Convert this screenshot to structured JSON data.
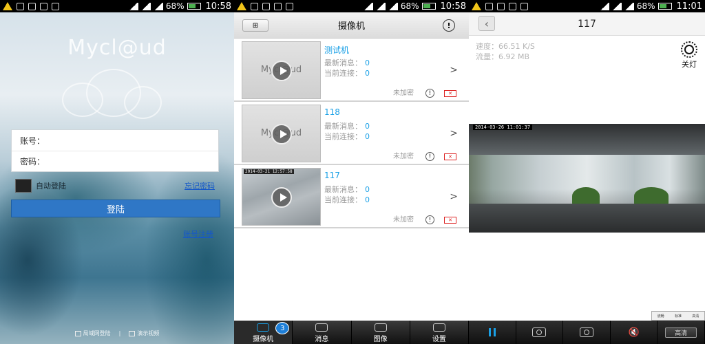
{
  "status_bars": [
    {
      "battery": "68%",
      "time": "10:58"
    },
    {
      "battery": "68%",
      "time": "10:58"
    },
    {
      "battery": "68%",
      "time": "11:01"
    }
  ],
  "login": {
    "logo": "Mycl@ud",
    "account_label": "账号：",
    "password_label": "密码：",
    "auto_login": "自动登陆",
    "forgot_password": "忘记密码",
    "login_button": "登陆",
    "register": "账号注册",
    "lan_login": "局域网登陆",
    "demo_video": "演示视频"
  },
  "camera_list": {
    "title": "摄像机",
    "msg_label": "最新消息：",
    "conn_label": "当前连接：",
    "unencrypted": "未加密",
    "cameras": [
      {
        "name": "测试机",
        "messages": "0",
        "connections": "0",
        "thumb": "logo",
        "timestamp": ""
      },
      {
        "name": "118",
        "messages": "0",
        "connections": "0",
        "thumb": "logo",
        "timestamp": ""
      },
      {
        "name": "117",
        "messages": "0",
        "connections": "0",
        "thumb": "photo",
        "timestamp": "2014-03-21 12:57:58"
      }
    ],
    "thumb_logo": "Mycl@ud",
    "tabs": [
      {
        "label": "摄像机",
        "icon": "camera-icon",
        "badge": "3",
        "active": true
      },
      {
        "label": "消息",
        "icon": "message-icon",
        "badge": "",
        "active": false
      },
      {
        "label": "图像",
        "icon": "image-icon",
        "badge": "",
        "active": false
      },
      {
        "label": "设置",
        "icon": "gear-icon",
        "badge": "",
        "active": false
      }
    ]
  },
  "camera_view": {
    "title": "117",
    "speed": "速度：66.51 K/S",
    "traffic": "流量：6.92 MB",
    "light_label": "关灯",
    "video_timestamp": "2014-03-26 11:01:37",
    "quality_options": [
      "流畅",
      "标准",
      "高清"
    ],
    "hd_button": "高清",
    "accent": "#1aa0e6"
  }
}
